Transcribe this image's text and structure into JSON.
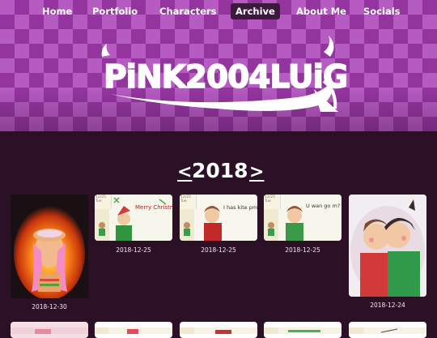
{
  "nav": {
    "items": [
      {
        "label": "Home",
        "active": false
      },
      {
        "label": "Portfolio",
        "active": false
      },
      {
        "label": "Characters",
        "active": false
      },
      {
        "label": "Archive",
        "active": true
      },
      {
        "label": "About Me",
        "active": false
      },
      {
        "label": "Socials",
        "active": false
      }
    ]
  },
  "banner": {
    "logo_text": "PiNK2004LUiGi"
  },
  "archive": {
    "year": "2018",
    "prev_arrow": "<",
    "next_arrow": ">"
  },
  "gallery": {
    "items": [
      {
        "date": "2018-12-30"
      },
      {
        "date": "2018-12-25",
        "note": "12/25 Tue",
        "caption": "Merry Christmas"
      },
      {
        "date": "2018-12-25",
        "note": "12/25 Tue",
        "caption": "I has kite pm"
      },
      {
        "date": "2018-12-25",
        "note": "12/25 Tue",
        "caption": "U wan go m?"
      },
      {
        "date": "2018-12-24"
      }
    ]
  },
  "colors": {
    "page_bg": "#2b1026",
    "banner_light": "#b55bc2",
    "banner_dark": "#93349f",
    "nav_active_bg": "#3d1a3d"
  }
}
